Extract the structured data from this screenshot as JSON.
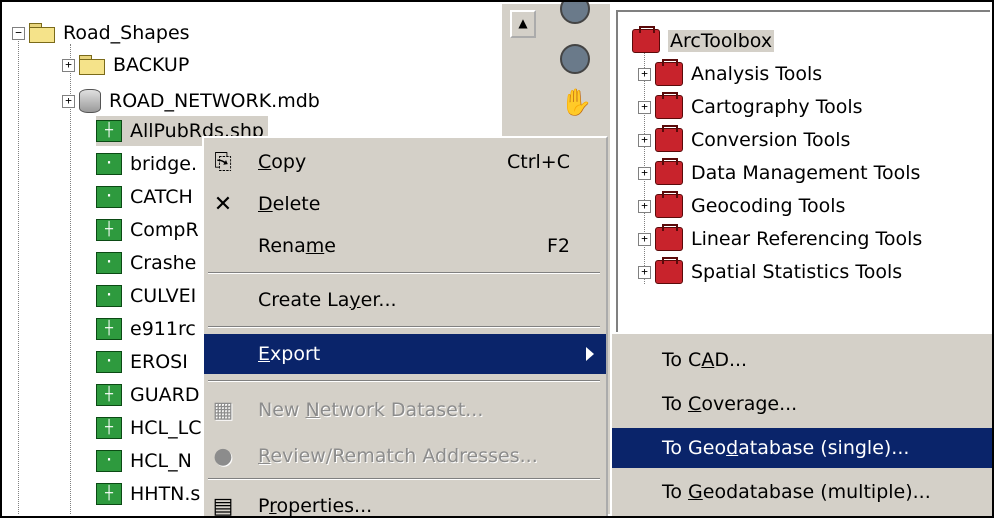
{
  "tree": {
    "root": {
      "label": "Road_Shapes",
      "expander": "−"
    },
    "children": [
      {
        "label": "BACKUP",
        "icon": "folder-icon",
        "expander": "+"
      },
      {
        "label": "ROAD_NETWORK.mdb",
        "icon": "database-icon",
        "expander": "+"
      }
    ],
    "shapefiles": [
      {
        "label": "AllPubRds.shp",
        "glyph": "┼"
      },
      {
        "label": "bridge.",
        "glyph": "·"
      },
      {
        "label": "CATCH",
        "glyph": "·"
      },
      {
        "label": "CompR",
        "glyph": "┼"
      },
      {
        "label": "Crashe",
        "glyph": "·"
      },
      {
        "label": "CULVEI",
        "glyph": "·"
      },
      {
        "label": "e911rc",
        "glyph": "┼"
      },
      {
        "label": "EROSI",
        "glyph": "·"
      },
      {
        "label": "GUARD",
        "glyph": "┼"
      },
      {
        "label": "HCL_LC",
        "glyph": "┼"
      },
      {
        "label": "HCL_N",
        "glyph": "·"
      },
      {
        "label": "HHTN.s",
        "glyph": "┼"
      }
    ]
  },
  "toolbox": {
    "root": "ArcToolbox",
    "items": [
      "Analysis Tools",
      "Cartography Tools",
      "Conversion Tools",
      "Data Management Tools",
      "Geocoding Tools",
      "Linear Referencing Tools",
      "Spatial Statistics Tools"
    ]
  },
  "context_menu": {
    "copy": {
      "pre": "",
      "u": "C",
      "post": "opy",
      "shortcut": "Ctrl+C",
      "icon": "copy-icon",
      "glyph": "⎘"
    },
    "delete": {
      "pre": "",
      "u": "D",
      "post": "elete",
      "icon": "delete-icon",
      "glyph": "✕"
    },
    "rename": {
      "pre": "Rena",
      "u": "m",
      "post": "e",
      "shortcut": "F2"
    },
    "create_layer": {
      "pre": "Create La",
      "u": "y",
      "post": "er..."
    },
    "export": {
      "pre": "",
      "u": "E",
      "post": "xport"
    },
    "new_network": {
      "pre": "New ",
      "u": "N",
      "post": "etwork Dataset...",
      "icon": "network-dataset-icon",
      "glyph": "▦"
    },
    "review": {
      "pre": "",
      "u": "R",
      "post": "eview/Rematch Addresses...",
      "icon": "geocode-icon",
      "glyph": "●"
    },
    "properties": {
      "pre": "P",
      "u": "r",
      "post": "operties...",
      "icon": "properties-icon",
      "glyph": "▤"
    }
  },
  "export_submenu": {
    "to_cad": {
      "pre": "To C",
      "u": "A",
      "post": "D..."
    },
    "to_coverage": {
      "pre": "To ",
      "u": "C",
      "post": "overage..."
    },
    "to_gdb_single": {
      "pre": "To Geo",
      "u": "d",
      "post": "atabase (single)..."
    },
    "to_gdb_multiple": {
      "pre": "To ",
      "u": "G",
      "post": "eodatabase (multiple)..."
    }
  },
  "colors": {
    "selection": "#0a246a",
    "shapefile_icon": "#2e9a3e",
    "toolbox_icon": "#c8232c"
  }
}
